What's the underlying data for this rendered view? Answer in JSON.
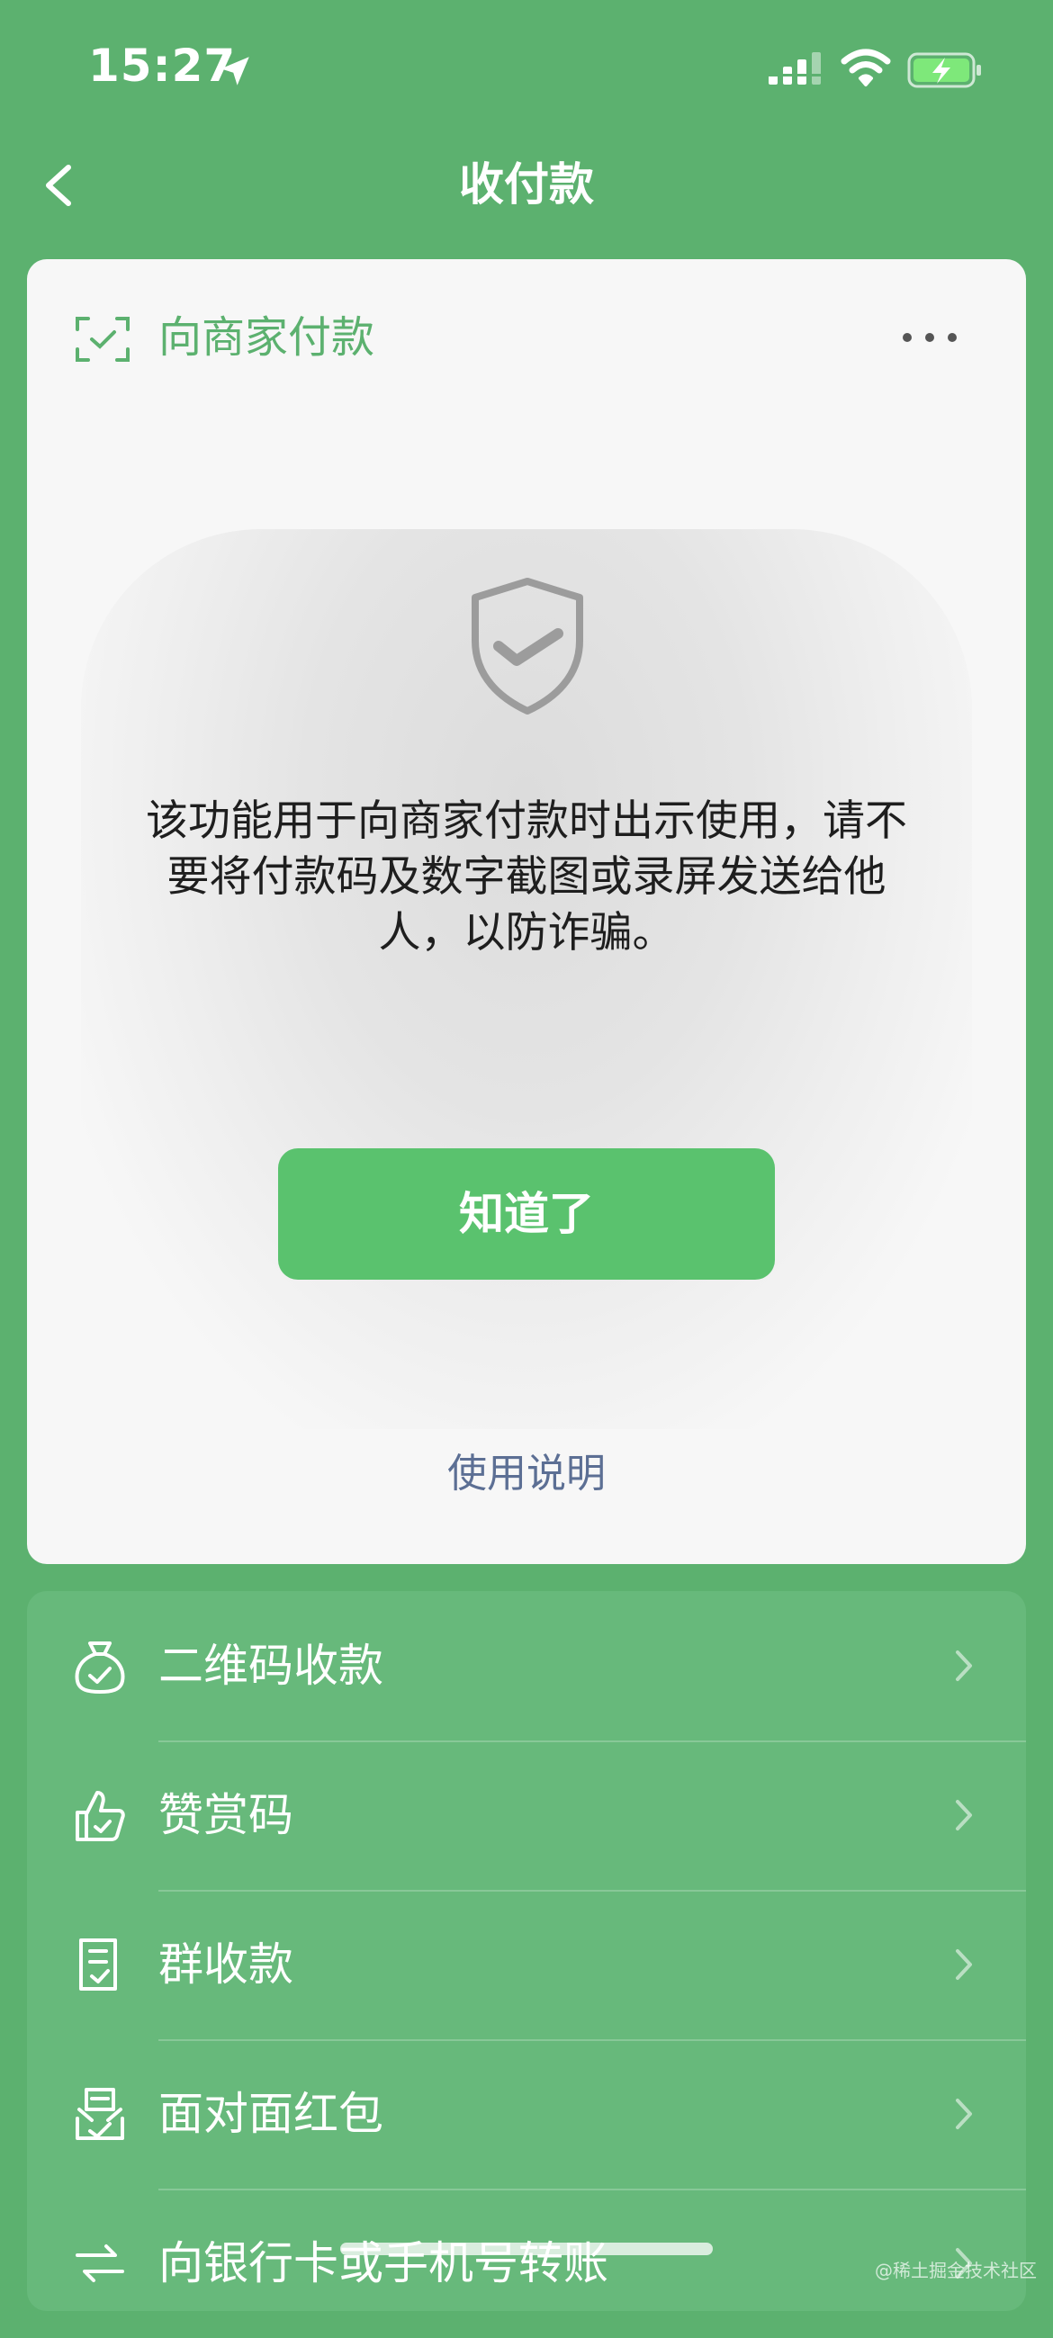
{
  "status_bar": {
    "time": "15:27",
    "icons": [
      "location-arrow-icon",
      "cellular-signal-icon",
      "wifi-icon",
      "battery-charging-icon"
    ]
  },
  "nav": {
    "title": "收付款",
    "back_icon": "chevron-left-icon"
  },
  "pay_card": {
    "title": "向商家付款",
    "header_icon": "scan-check-icon",
    "more_icon": "ellipsis-icon",
    "shield_icon": "shield-check-icon",
    "warning_lines": [
      "该功能用于向商家付款时出示使用，请不",
      "要将付款码及数字截图或录屏发送给他",
      "人，以防诈骗。"
    ],
    "ok_button": "知道了",
    "help_link": "使用说明"
  },
  "menu": {
    "items": [
      {
        "label": "二维码收款",
        "icon": "money-bag-icon"
      },
      {
        "label": "赞赏码",
        "icon": "thumbs-up-icon"
      },
      {
        "label": "群收款",
        "icon": "group-bill-icon"
      },
      {
        "label": "面对面红包",
        "icon": "red-packet-icon"
      },
      {
        "label": "向银行卡或手机号转账",
        "icon": "transfer-icon"
      }
    ]
  },
  "watermark": "@稀土掘金技术社区",
  "colors": {
    "background": "#5cb16f",
    "card": "#f7f7f7",
    "accent": "#5ac26e",
    "link": "#5c6f94",
    "menu_bg": "#67b97b"
  }
}
